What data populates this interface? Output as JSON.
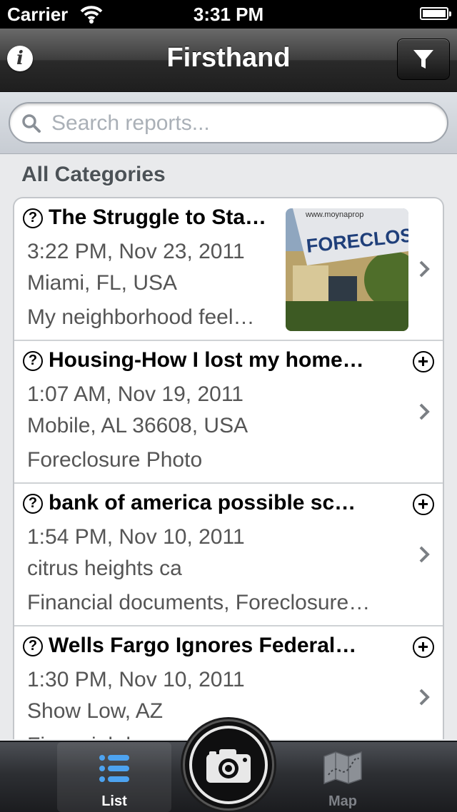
{
  "status_bar": {
    "carrier": "Carrier",
    "time": "3:31 PM"
  },
  "nav": {
    "title": "Firsthand",
    "info_glyph": "i",
    "filter_icon": "filter-icon"
  },
  "search": {
    "placeholder": "Search reports..."
  },
  "section": {
    "header": "All Categories"
  },
  "reports": [
    {
      "title": "The Struggle to Sta…",
      "time": "3:22 PM, Nov 23, 2011",
      "location": "Miami, FL, USA",
      "summary": "My neighborhood feel…",
      "thumbnail_text": "FORECLOSUR",
      "thumbnail_sign": "www.moynaprop"
    },
    {
      "title": "Housing-How I lost my home…",
      "time": "1:07 AM, Nov 19, 2011",
      "location": "Mobile, AL 36608, USA",
      "summary": "Foreclosure Photo"
    },
    {
      "title": "bank of america possible  sc…",
      "time": "1:54 PM, Nov 10, 2011",
      "location": "citrus heights ca",
      "summary": "Financial documents, Foreclosure…"
    },
    {
      "title": "Wells Fargo Ignores Federal…",
      "time": "1:30 PM, Nov 10, 2011",
      "location": "Show Low, AZ",
      "summary": "Financial docum…"
    }
  ],
  "tabbar": {
    "list_label": "List",
    "map_label": "Map"
  },
  "colors": {
    "navbar": "#2a2a2a",
    "tab_active": "#4da3f0",
    "tab_inactive": "#7e8187"
  }
}
